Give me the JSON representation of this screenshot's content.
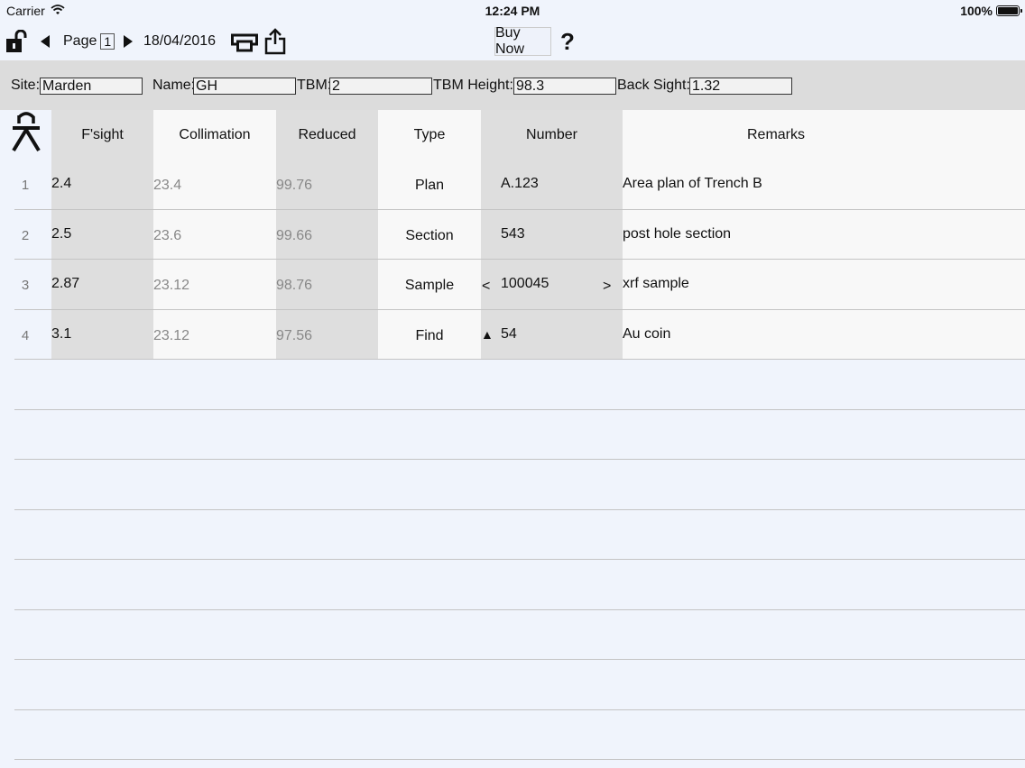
{
  "status_bar": {
    "carrier": "Carrier",
    "time": "12:24 PM",
    "battery": "100%",
    "battery_level": 1.0
  },
  "toolbar": {
    "lock_icon": "unlocked-padlock-icon",
    "page_label": "Page",
    "page_number": "1",
    "date": "18/04/2016",
    "buy_now": "Buy Now",
    "help": "?"
  },
  "header_fields": {
    "site_label": "Site:",
    "site_value": "Marden",
    "name_label": "Name:",
    "name_value": "GH",
    "tbm_label": "TBM:",
    "tbm_value": "2",
    "tbm_height_label": "TBM Height:",
    "tbm_height_value": "98.3",
    "back_sight_label": "Back Sight:",
    "back_sight_value": "1.32"
  },
  "table": {
    "level_icon": "surveyor-level-icon",
    "columns": [
      "F'sight",
      "Collimation",
      "Reduced",
      "Type",
      "Number",
      "Remarks"
    ],
    "rows": [
      {
        "index": "1",
        "fsight": "2.4",
        "collimation": "23.4",
        "reduced": "99.76",
        "type": "Plan",
        "number_prefix": "",
        "number": "A.123",
        "number_suffix": "",
        "remarks": "Area plan of Trench B"
      },
      {
        "index": "2",
        "fsight": "2.5",
        "collimation": "23.6",
        "reduced": "99.66",
        "type": "Section",
        "number_prefix": "",
        "number": "543",
        "number_suffix": "",
        "remarks": "post hole section"
      },
      {
        "index": "3",
        "fsight": "2.87",
        "collimation": "23.12",
        "reduced": "98.76",
        "type": "Sample",
        "number_prefix": "<",
        "number": "100045",
        "number_suffix": ">",
        "remarks": "xrf sample"
      },
      {
        "index": "4",
        "fsight": "3.1",
        "collimation": "23.12",
        "reduced": "97.56",
        "type": "Find",
        "number_prefix": "▲",
        "number": "54",
        "number_suffix": "",
        "remarks": "Au coin"
      }
    ]
  },
  "colors": {
    "background": "#f0f4fc",
    "field_bar": "#dcdcdc",
    "band_gray": "#dedede",
    "band_white": "#f8f8f8"
  }
}
